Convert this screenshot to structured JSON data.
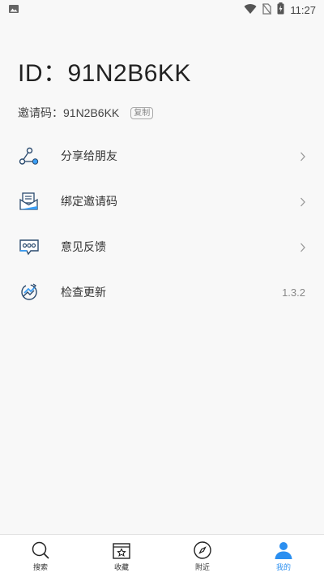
{
  "status_bar": {
    "time": "11:27",
    "icons": [
      "image-icon",
      "wifi-icon",
      "no-sim-icon",
      "battery-charging-icon"
    ]
  },
  "profile": {
    "id_text": "ID：91N2B6KK",
    "invite_label": "邀请码：",
    "invite_code": "91N2B6KK",
    "copy_label": "复制"
  },
  "menu": {
    "items": [
      {
        "label": "分享给朋友",
        "icon": "share-icon",
        "value": ""
      },
      {
        "label": "绑定邀请码",
        "icon": "envelope-icon",
        "value": ""
      },
      {
        "label": "意见反馈",
        "icon": "chat-bubble-icon",
        "value": ""
      },
      {
        "label": "检查更新",
        "icon": "refresh-icon",
        "value": "1.3.2"
      }
    ]
  },
  "tabbar": {
    "tabs": [
      {
        "label": "搜索",
        "icon": "search-icon",
        "active": false
      },
      {
        "label": "收藏",
        "icon": "favorites-icon",
        "active": false
      },
      {
        "label": "附近",
        "icon": "compass-icon",
        "active": false
      },
      {
        "label": "我的",
        "icon": "user-icon",
        "active": true
      }
    ]
  },
  "colors": {
    "accent": "#2b8ff0",
    "icon_stroke": "#2a4a6e",
    "background": "#f8f8f8",
    "tabbar_bg": "#ffffff"
  }
}
